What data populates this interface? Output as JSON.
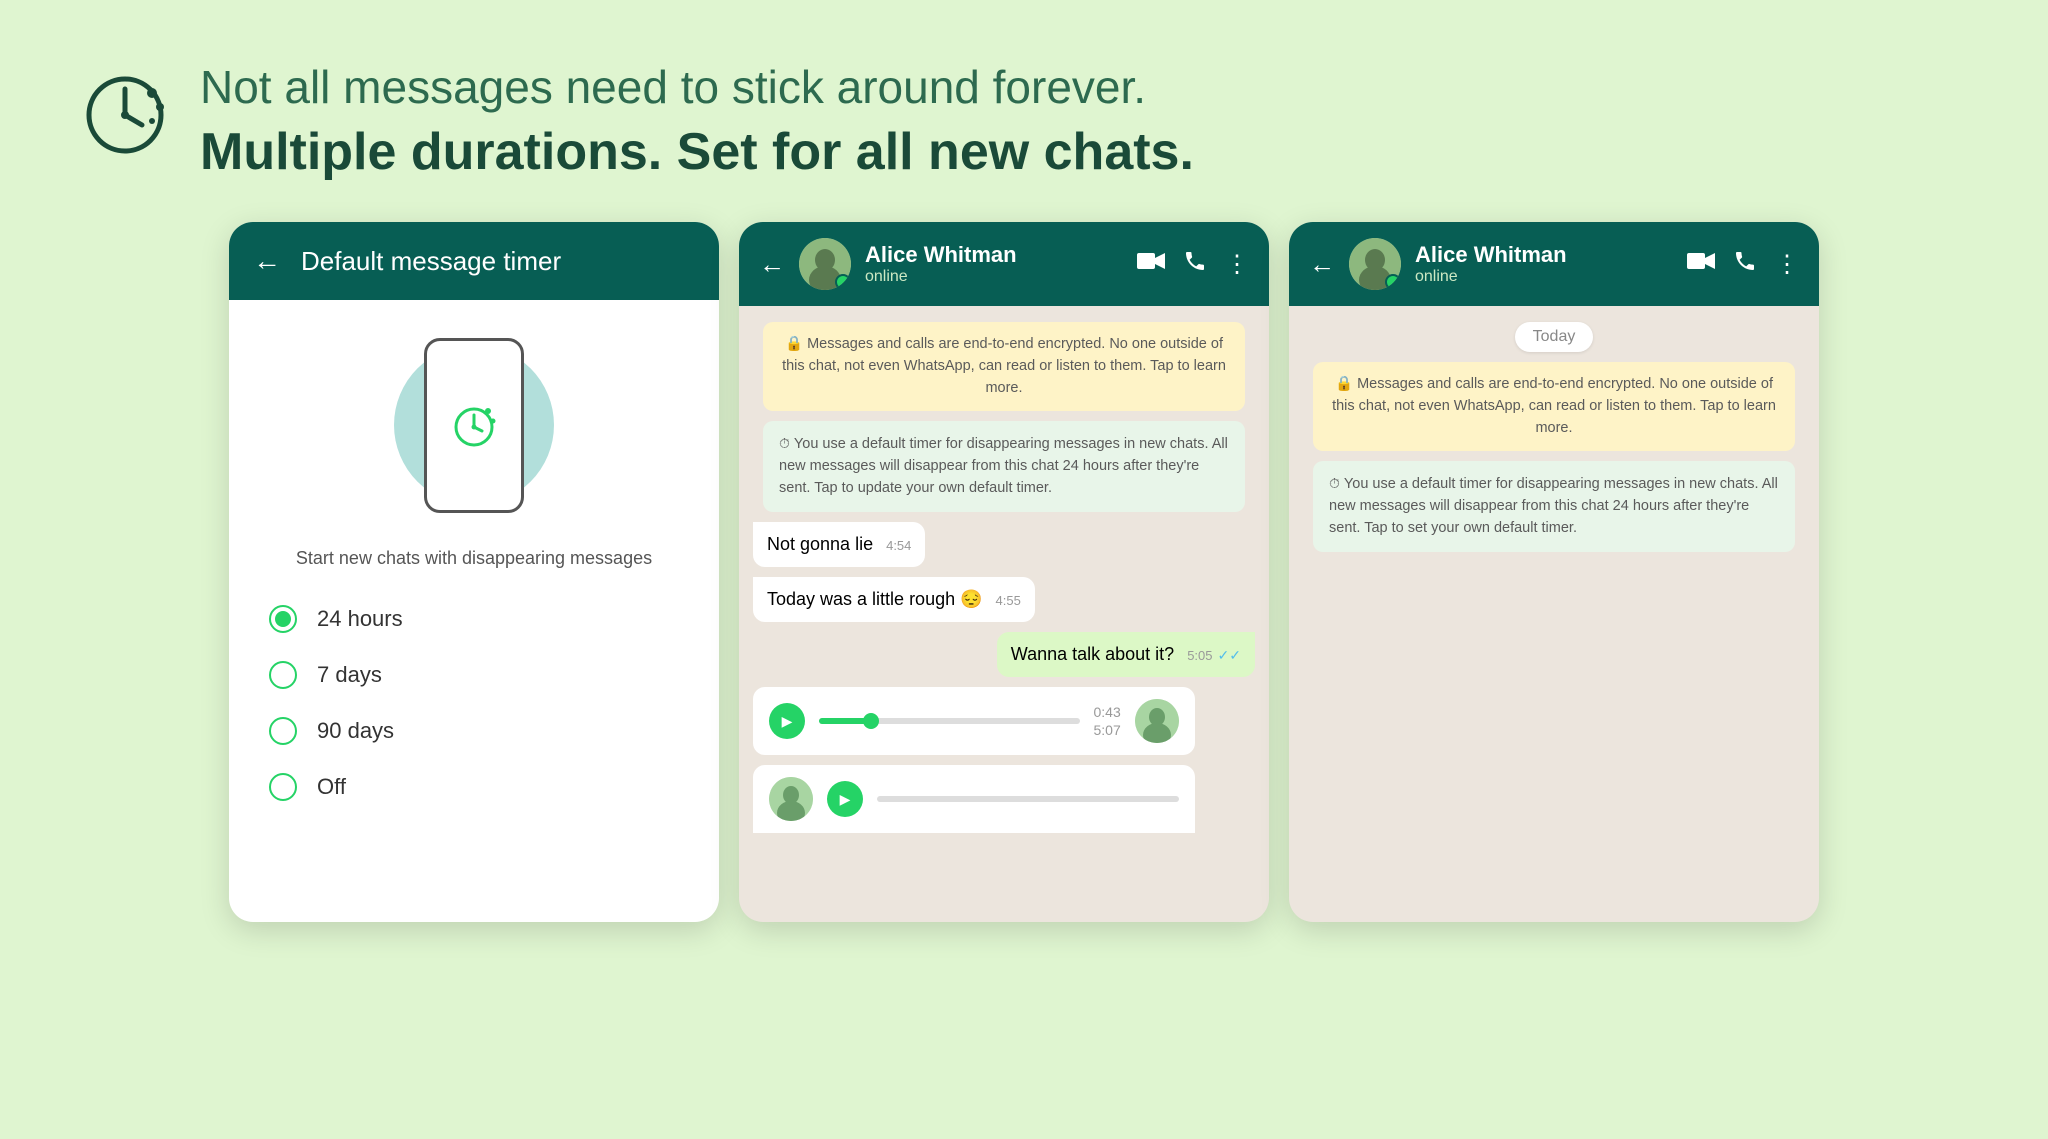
{
  "header": {
    "line1": "Not all messages need to stick around forever.",
    "line2": "Multiple durations. Set for all new chats."
  },
  "panel1": {
    "title": "Default message timer",
    "subtitle": "Start new chats with disappearing messages",
    "options": [
      {
        "label": "24 hours",
        "selected": true
      },
      {
        "label": "7 days",
        "selected": false
      },
      {
        "label": "90 days",
        "selected": false
      },
      {
        "label": "Off",
        "selected": false
      }
    ]
  },
  "panel2": {
    "contact": "Alice Whitman",
    "status": "online",
    "encryption_msg": "🔒 Messages and calls are end-to-end encrypted. No one outside of this chat, not even WhatsApp, can read or listen to them. Tap to learn more.",
    "timer_msg": "You use a default timer for disappearing messages in new chats. All new messages will disappear from this chat 24 hours after they're sent. Tap to update your own default timer.",
    "messages": [
      {
        "text": "Not gonna lie",
        "time": "4:54",
        "type": "received"
      },
      {
        "text": "Today was a little rough 😔",
        "time": "4:55",
        "type": "received"
      },
      {
        "text": "Wanna talk about it?",
        "time": "5:05",
        "type": "sent",
        "ticks": true
      }
    ],
    "voice1": {
      "time_elapsed": "0:43",
      "time_total": "5:07"
    }
  },
  "panel3": {
    "contact": "Alice Whitman",
    "status": "online",
    "today_label": "Today",
    "encryption_msg": "🔒 Messages and calls are end-to-end encrypted. No one outside of this chat, not even WhatsApp, can read or listen to them. Tap to learn more.",
    "timer_msg": "You use a default timer for disappearing messages in new chats. All new messages will disappear from this chat 24 hours after they're sent. Tap to set your own default timer."
  }
}
